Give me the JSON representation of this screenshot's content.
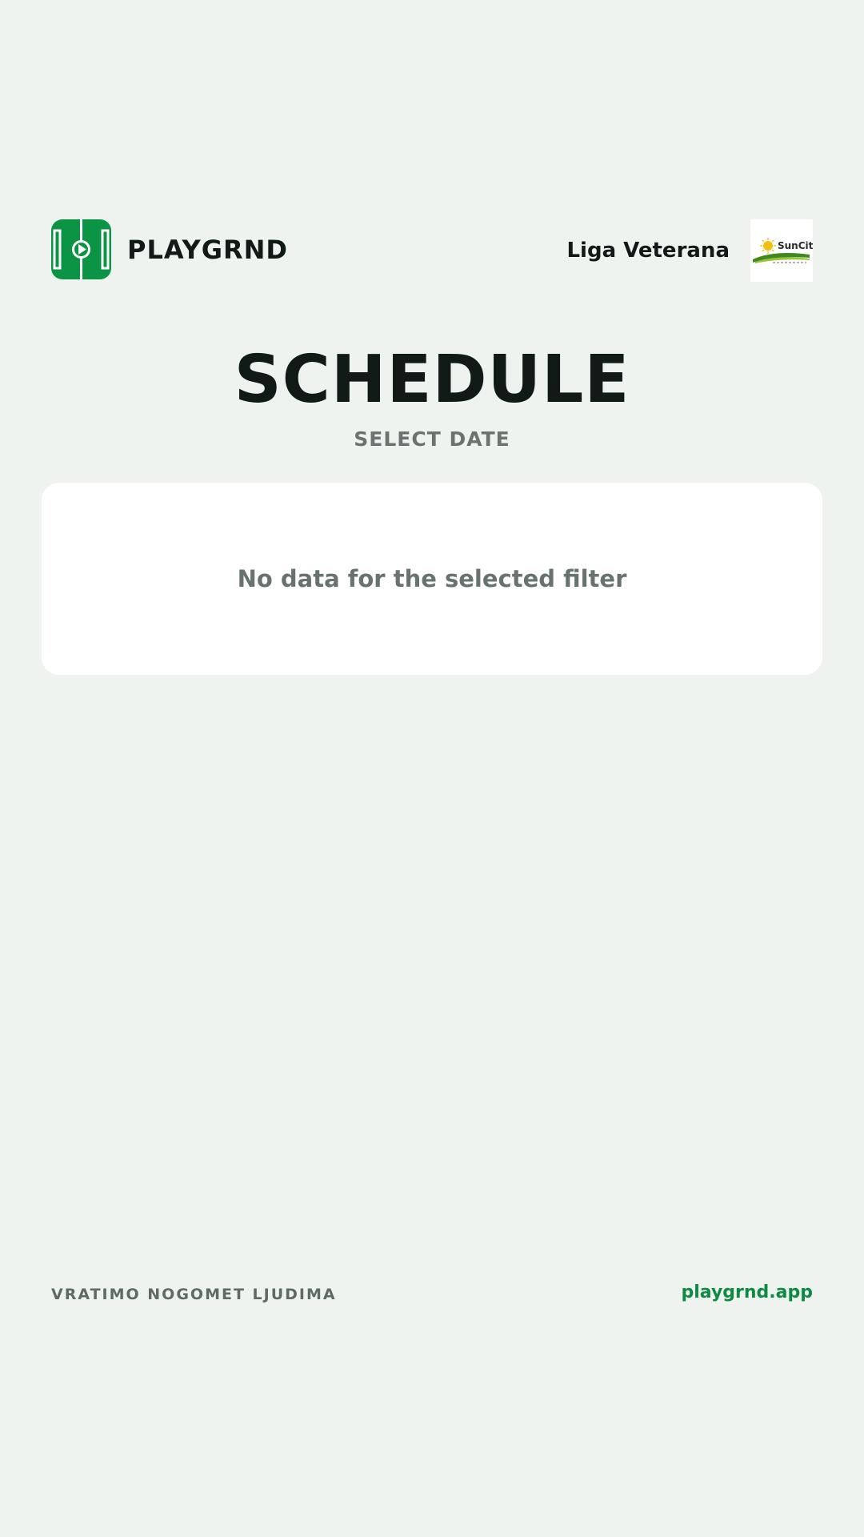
{
  "header": {
    "brand_name": "PLAYGRND",
    "league_name": "Liga Veterana",
    "league_logo_text": "SunCity",
    "brand_color": "#0b9444"
  },
  "main": {
    "title": "SCHEDULE",
    "subtitle": "SELECT DATE",
    "empty_message": "No data for the selected filter"
  },
  "footer": {
    "tagline": "VRATIMO NOGOMET LJUDIMA",
    "link": "playgrnd.app",
    "link_color": "#0e8a43"
  },
  "colors": {
    "background": "#eff3f0",
    "card": "#ffffff",
    "text_primary": "#111a16",
    "text_muted": "#6a736f"
  }
}
